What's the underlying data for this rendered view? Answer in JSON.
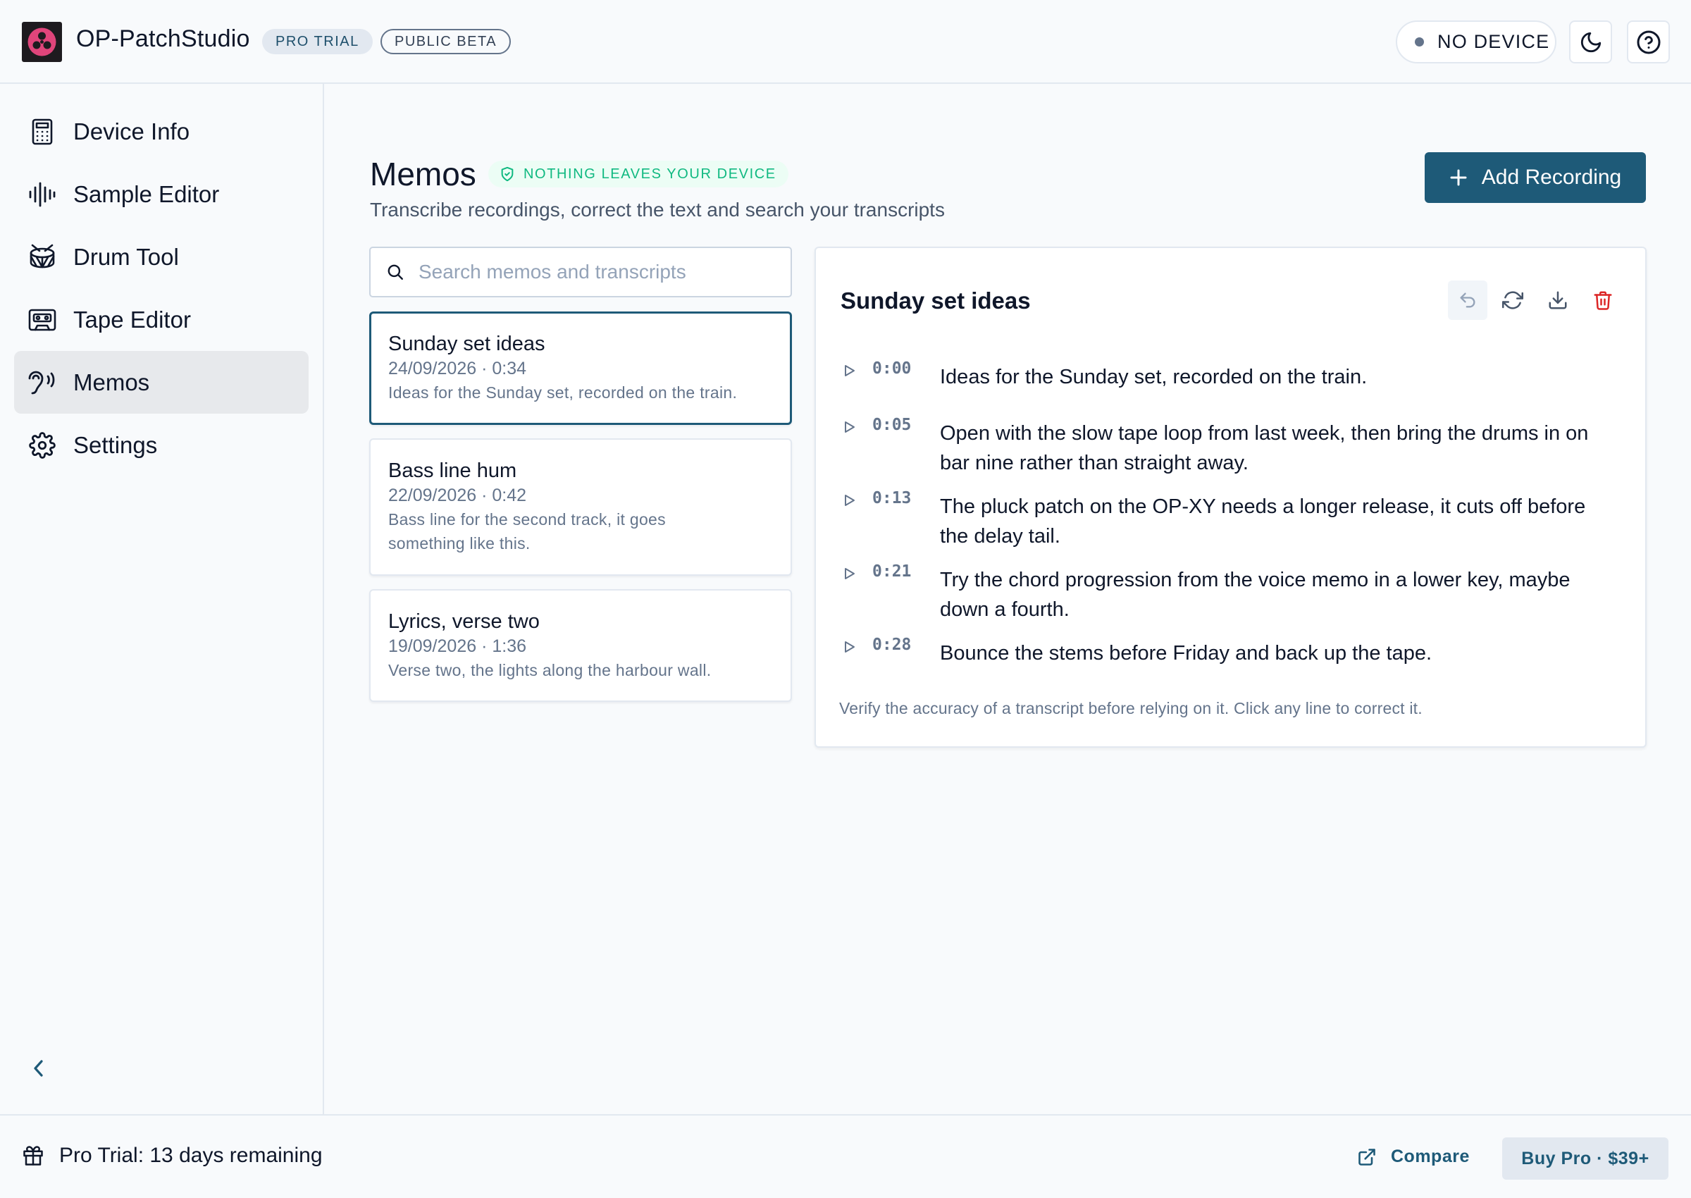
{
  "header": {
    "app_title": "OP-PatchStudio",
    "badge_pro": "PRO TRIAL",
    "badge_beta": "PUBLIC BETA",
    "device_status": "NO DEVICE",
    "icons": [
      "logo-icon",
      "moon-icon",
      "help-icon"
    ]
  },
  "sidebar": {
    "items": [
      {
        "label": "Device Info",
        "icon": "calculator-icon",
        "active": false
      },
      {
        "label": "Sample Editor",
        "icon": "waveform-icon",
        "active": false
      },
      {
        "label": "Drum Tool",
        "icon": "drum-icon",
        "active": false
      },
      {
        "label": "Tape Editor",
        "icon": "cassette-icon",
        "active": false
      },
      {
        "label": "Memos",
        "icon": "ear-icon",
        "active": true
      },
      {
        "label": "Settings",
        "icon": "gear-icon",
        "active": false
      }
    ],
    "collapse_icon": "chevron-left-icon"
  },
  "main": {
    "title": "Memos",
    "privacy_badge": "NOTHING LEAVES YOUR DEVICE",
    "subtitle": "Transcribe recordings, correct the text and search your transcripts",
    "add_button": "Add Recording",
    "search_placeholder": "Search memos and transcripts",
    "memos": [
      {
        "title": "Sunday set ideas",
        "meta": "24/09/2026 · 0:34",
        "snippet": "Ideas for the Sunday set, recorded on the train.",
        "selected": true
      },
      {
        "title": "Bass line hum",
        "meta": "22/09/2026 · 0:42",
        "snippet": "Bass line for the second track, it goes something like this.",
        "selected": false
      },
      {
        "title": "Lyrics, verse two",
        "meta": "19/09/2026 · 1:36",
        "snippet": "Verse two, the lights along the harbour wall.",
        "selected": false
      }
    ],
    "detail": {
      "title": "Sunday set ideas",
      "toolbar_icons": [
        "undo-icon",
        "refresh-icon",
        "download-icon",
        "trash-icon"
      ],
      "lines": [
        {
          "time": "0:00",
          "text": "Ideas for the Sunday set, recorded on the train."
        },
        {
          "time": "0:05",
          "text": "Open with the slow tape loop from last week, then bring the drums in on bar nine rather than straight away."
        },
        {
          "time": "0:13",
          "text": "The pluck patch on the OP-XY needs a longer release, it cuts off before the delay tail."
        },
        {
          "time": "0:21",
          "text": "Try the chord progression from the voice memo in a lower key, maybe down a fourth."
        },
        {
          "time": "0:28",
          "text": "Bounce the stems before Friday and back up the tape."
        }
      ],
      "disclaimer": "Verify the accuracy of a transcript before relying on it. Click any line to correct it."
    }
  },
  "footer": {
    "trial_text": "Pro Trial: 13 days remaining",
    "compare_label": "Compare",
    "buy_label": "Buy Pro · $39+"
  },
  "colors": {
    "accent": "#1e5a78",
    "success": "#10b981",
    "danger": "#dc2626",
    "background": "#f8fafc"
  }
}
